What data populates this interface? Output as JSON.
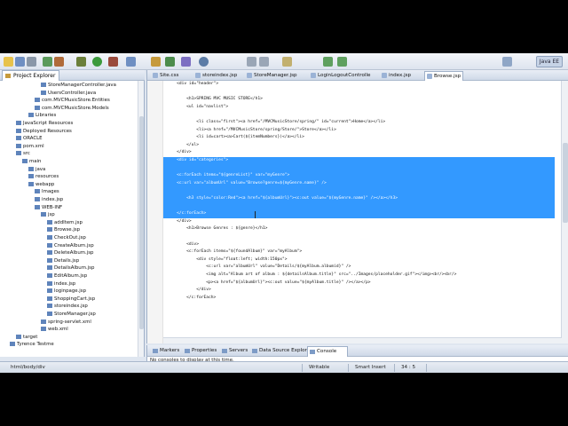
{
  "toolbar": {
    "perspective_label": "Java EE"
  },
  "project_explorer": {
    "tab_label": "Project Explorer",
    "items": [
      {
        "label": "StoreManagerController.java",
        "indent": 6
      },
      {
        "label": "UsersController.java",
        "indent": 6
      },
      {
        "label": "com.MVCMusicStore.Entities",
        "indent": 5
      },
      {
        "label": "com.MVCMusicStore.Models",
        "indent": 5
      },
      {
        "label": "Libraries",
        "indent": 4
      },
      {
        "label": "JavaScript Resources",
        "indent": 2
      },
      {
        "label": "Deployed Resources",
        "indent": 2
      },
      {
        "label": "ORACLE",
        "indent": 2
      },
      {
        "label": "pom.xml",
        "indent": 2
      },
      {
        "label": "src",
        "indent": 2
      },
      {
        "label": "main",
        "indent": 3
      },
      {
        "label": "java",
        "indent": 4
      },
      {
        "label": "resources",
        "indent": 4
      },
      {
        "label": "webapp",
        "indent": 4
      },
      {
        "label": "Images",
        "indent": 5
      },
      {
        "label": "index.jsp",
        "indent": 5
      },
      {
        "label": "WEB-INF",
        "indent": 5
      },
      {
        "label": "jsp",
        "indent": 6
      },
      {
        "label": "addItem.jsp",
        "indent": 7
      },
      {
        "label": "Browse.jsp",
        "indent": 7
      },
      {
        "label": "CheckOut.jsp",
        "indent": 7
      },
      {
        "label": "CreateAlbum.jsp",
        "indent": 7
      },
      {
        "label": "DeleteAlbum.jsp",
        "indent": 7
      },
      {
        "label": "Details.jsp",
        "indent": 7
      },
      {
        "label": "DetailsAlbum.jsp",
        "indent": 7
      },
      {
        "label": "EditAlbum.jsp",
        "indent": 7
      },
      {
        "label": "index.jsp",
        "indent": 7
      },
      {
        "label": "loginpage.jsp",
        "indent": 7
      },
      {
        "label": "ShoppingCart.jsp",
        "indent": 7
      },
      {
        "label": "storeindex.jsp",
        "indent": 7
      },
      {
        "label": "StoreManager.jsp",
        "indent": 7
      },
      {
        "label": "spring-servlet.xml",
        "indent": 6
      },
      {
        "label": "web.xml",
        "indent": 6
      },
      {
        "label": "target",
        "indent": 2
      },
      {
        "label": "Tyrence Testme",
        "indent": 1
      }
    ]
  },
  "editor": {
    "tabs": [
      {
        "label": "Site.css",
        "active": false
      },
      {
        "label": "storeindex.jsp",
        "active": false
      },
      {
        "label": "StoreManager.jsp",
        "active": false
      },
      {
        "label": "LoginLogoutControlle",
        "active": false
      },
      {
        "label": "index.jsp",
        "active": false
      },
      {
        "label": "Browse.jsp",
        "active": true
      }
    ],
    "lines": [
      {
        "text": "    <div id=\"header\">",
        "selected": false
      },
      {
        "text": "",
        "selected": false
      },
      {
        "text": "        <h1>SPRING MVC MUSIC STORE</h1>",
        "selected": false
      },
      {
        "text": "        <ul id=\"navlist\">",
        "selected": false
      },
      {
        "text": "",
        "selected": false
      },
      {
        "text": "            <li class=\"first\"><a href=\"/MVCMusicStore/spring/\" id=\"current\">Home</a></li>",
        "selected": false
      },
      {
        "text": "            <li><a href=\"/MVCMusicStore/spring/Store/\">Store</a></li>",
        "selected": false
      },
      {
        "text": "            <li id=cart><a>Cart(${itemNumbers})</a></li>",
        "selected": false
      },
      {
        "text": "        </ul>",
        "selected": false
      },
      {
        "text": "    </div>",
        "selected": false
      },
      {
        "text": "    <div id=\"categories\">",
        "selected": true
      },
      {
        "text": "",
        "selected": true
      },
      {
        "text": "    <c:forEach items=\"${genreList}\" var=\"myGenre\">",
        "selected": true
      },
      {
        "text": "    <c:url var=\"albumUrl\" value=\"Browse?genre=${myGenre.name}\" />",
        "selected": true
      },
      {
        "text": "",
        "selected": true
      },
      {
        "text": "        <h3 style=\"color:Red\"><a href=\"${albumUrl}\"><c:out value=\"${myGenre.name}\" /></a></h3>",
        "selected": true
      },
      {
        "text": "",
        "selected": true
      },
      {
        "text": "    </c:forEach>",
        "selected": true
      },
      {
        "text": "    </div>",
        "selected": false
      },
      {
        "text": "        <h1>Browse Genres : ${genre}</h1>",
        "selected": false
      },
      {
        "text": "",
        "selected": false
      },
      {
        "text": "        <div>",
        "selected": false
      },
      {
        "text": "        <c:forEach items=\"${foundAlbum}\" var=\"myAlbum\">",
        "selected": false
      },
      {
        "text": "            <div style=\"float:left; width:150px\">",
        "selected": false
      },
      {
        "text": "                <c:url var=\"albumUrl\" value=\"Details/${myAlbum.albumid}\" />",
        "selected": false
      },
      {
        "text": "                <img alt=\"Album art of album : ${detailsAlbum.title}\" src=\"../Images/placeholder.gif\"></img><br/><br/>",
        "selected": false
      },
      {
        "text": "                <p><a href=\"${albumUrl}\"><c:out value=\"${myAlbum.title}\" /></a></p>",
        "selected": false
      },
      {
        "text": "            </div>",
        "selected": false
      },
      {
        "text": "        </c:forEach>",
        "selected": false
      }
    ]
  },
  "bottom_panel": {
    "tabs": [
      {
        "label": "Markers",
        "active": false
      },
      {
        "label": "Properties",
        "active": false
      },
      {
        "label": "Servers",
        "active": false
      },
      {
        "label": "Data Source Explorer",
        "active": false
      },
      {
        "label": "Console",
        "active": true
      }
    ],
    "console_message": "No consoles to display at this time."
  },
  "status_bar": {
    "path": "html/body/div",
    "writable": "Writable",
    "insert_mode": "Smart Insert",
    "position": "34 : 5"
  }
}
